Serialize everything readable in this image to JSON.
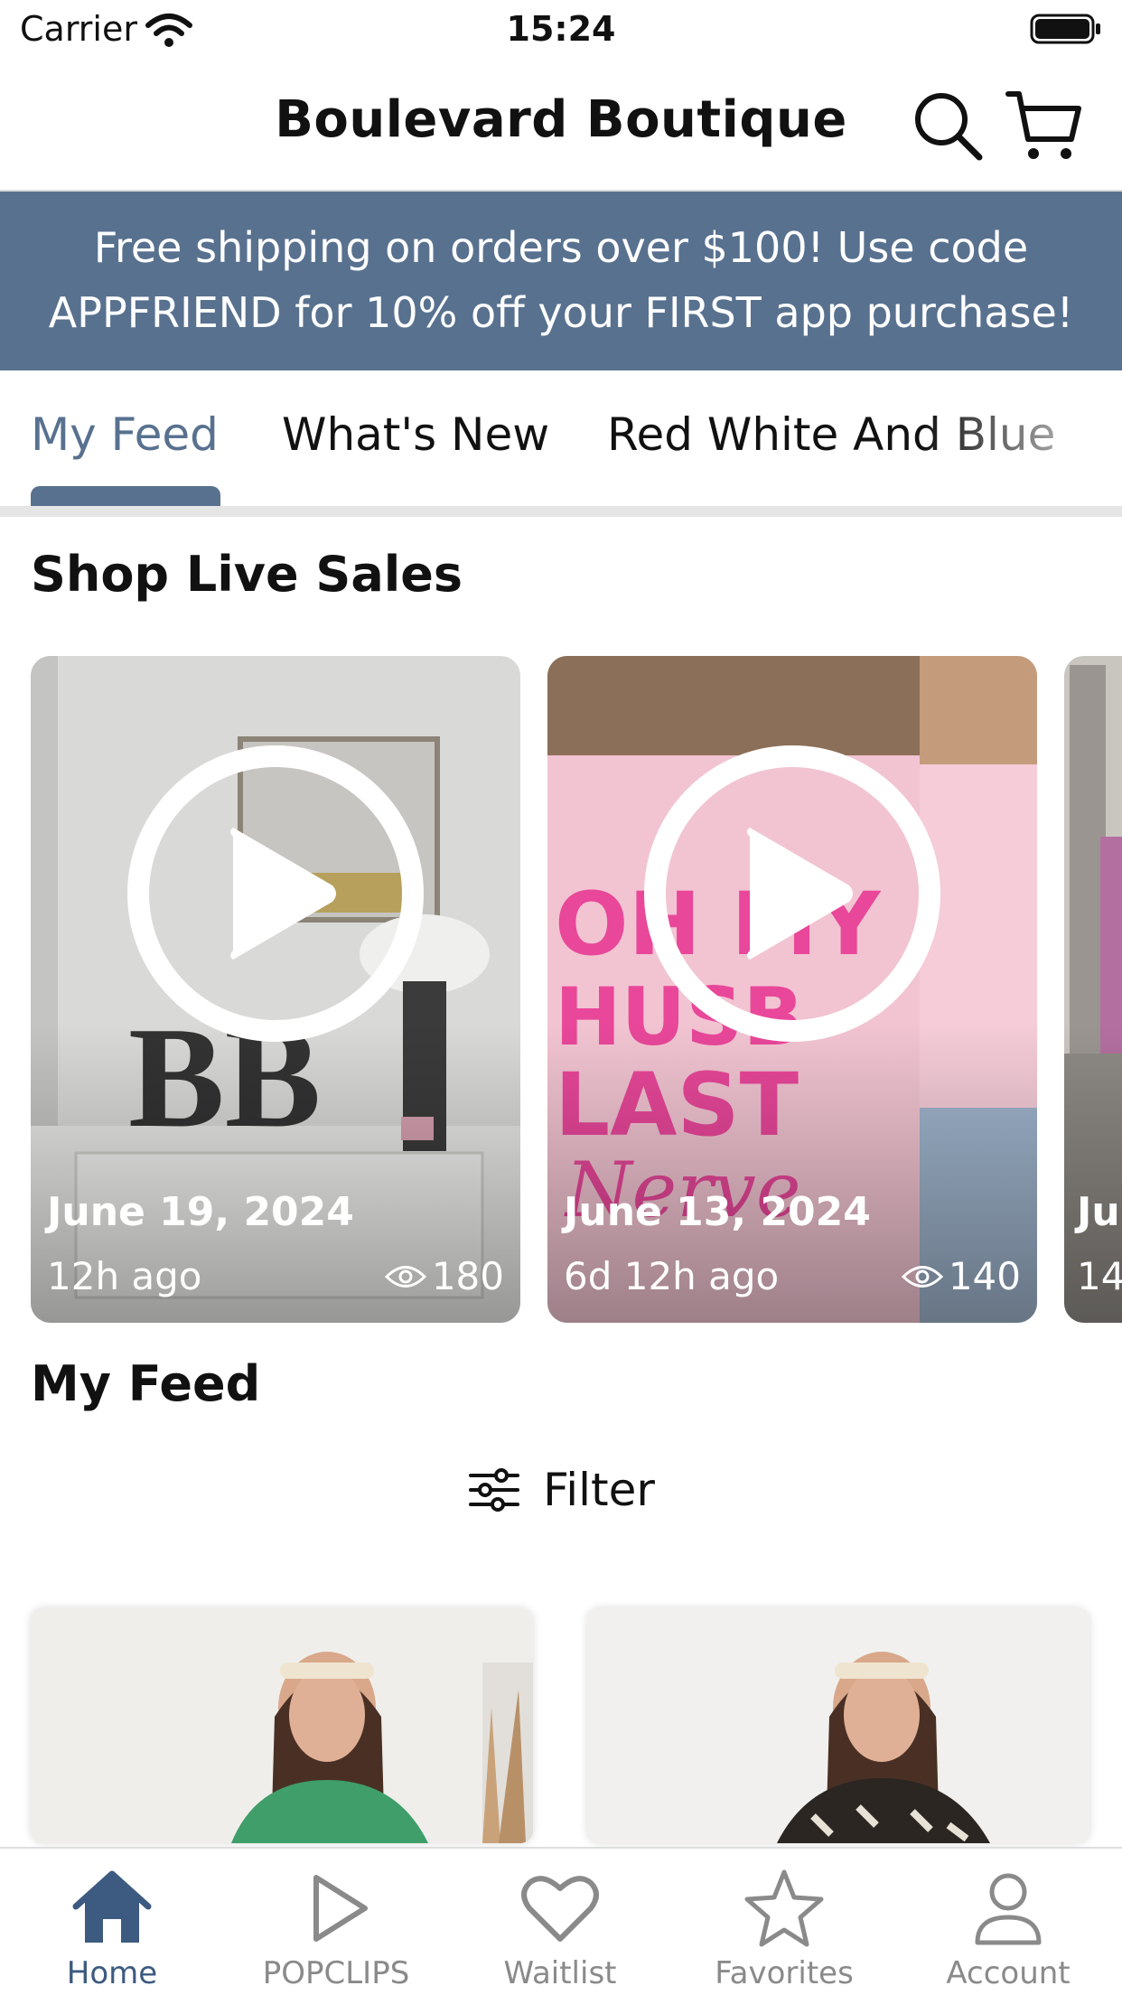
{
  "status_bar": {
    "carrier": "Carrier",
    "time": "15:24"
  },
  "header": {
    "title": "Boulevard Boutique",
    "icons": [
      "search-icon",
      "cart-icon"
    ]
  },
  "banner": {
    "line1": "Free shipping on orders over $100! Use code",
    "line2": "APPFRIEND for 10% off your FIRST app purchase!",
    "background": "#58718f"
  },
  "tabs": [
    {
      "label": "My Feed",
      "active": true
    },
    {
      "label": "What's New",
      "active": false
    },
    {
      "label": "Red White And Blue",
      "active": false
    }
  ],
  "accent_color": "#58718f",
  "live_sales": {
    "title": "Shop Live Sales",
    "cards": [
      {
        "date": "June 19, 2024",
        "ago": "12h ago",
        "views": "180"
      },
      {
        "date": "June 13, 2024",
        "ago": "6d 12h ago",
        "views": "140"
      },
      {
        "date": "Ju",
        "ago": "14",
        "views": ""
      }
    ]
  },
  "feed": {
    "title": "My Feed",
    "filter_label": "Filter"
  },
  "bottom_nav": [
    {
      "label": "Home",
      "icon": "home-icon",
      "active": true
    },
    {
      "label": "POPCLIPS",
      "icon": "play-icon",
      "active": false
    },
    {
      "label": "Waitlist",
      "icon": "heart-icon",
      "active": false
    },
    {
      "label": "Favorites",
      "icon": "star-icon",
      "active": false
    },
    {
      "label": "Account",
      "icon": "person-icon",
      "active": false
    }
  ]
}
